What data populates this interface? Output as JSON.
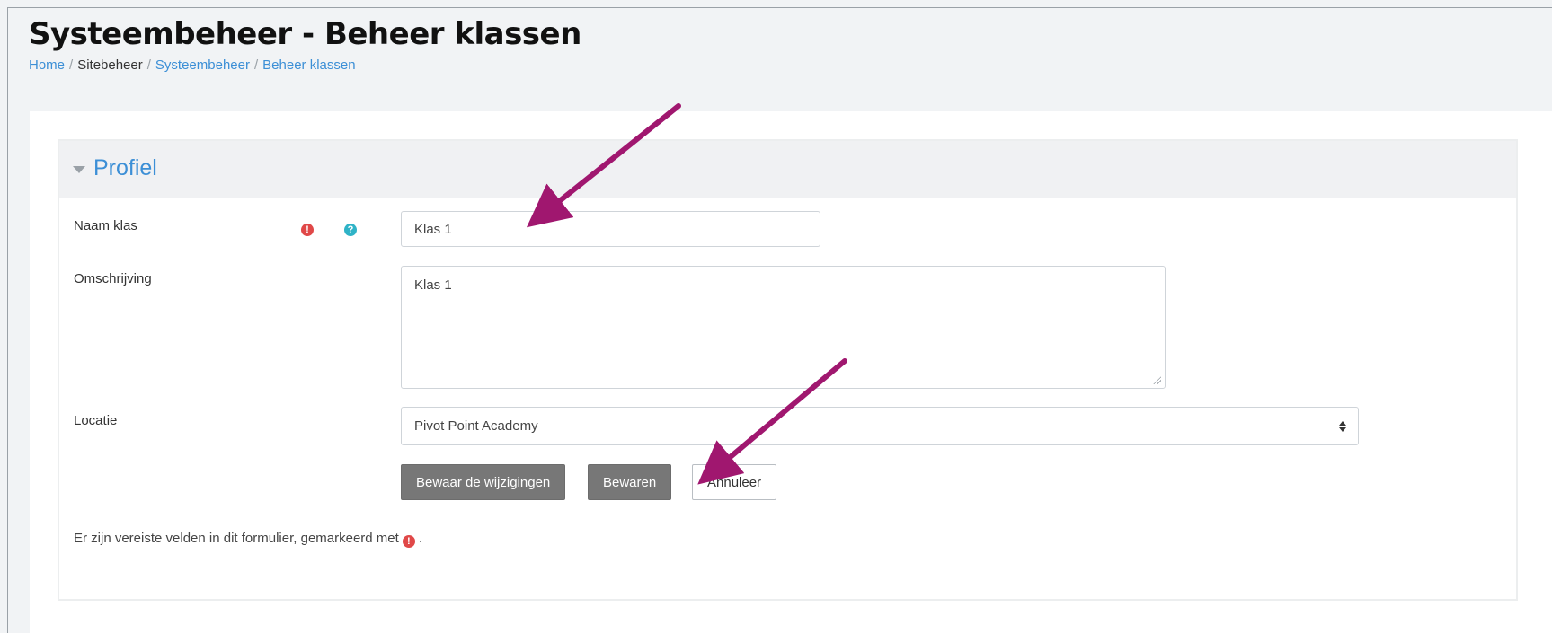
{
  "header": {
    "title": "Systeembeheer - Beheer klassen",
    "breadcrumb": [
      "Home",
      "Sitebeheer",
      "Systeembeheer",
      "Beheer klassen"
    ]
  },
  "section": {
    "title": "Profiel"
  },
  "form": {
    "naam_label": "Naam klas",
    "naam_value": "Klas 1",
    "omschrijving_label": "Omschrijving",
    "omschrijving_value": "Klas 1",
    "locatie_label": "Locatie",
    "locatie_value": "Pivot Point Academy",
    "required_icon": "!",
    "help_icon": "?"
  },
  "buttons": {
    "save_changes": "Bewaar de wijzigingen",
    "save": "Bewaren",
    "cancel": "Annuleer"
  },
  "note": {
    "text": "Er zijn vereiste velden in dit formulier, gemarkeerd met",
    "suffix": "."
  },
  "colors": {
    "accent": "#3c8fd6",
    "required": "#e04848",
    "help": "#2fb3c7",
    "annotation_arrow": "#a0176f",
    "button_dark": "#777777"
  },
  "icons": {
    "section_toggle": "triangle-down-icon",
    "required": "exclamation-circle-icon",
    "help": "question-circle-icon",
    "select": "sort-icon",
    "annotations": "arrow-icon"
  }
}
